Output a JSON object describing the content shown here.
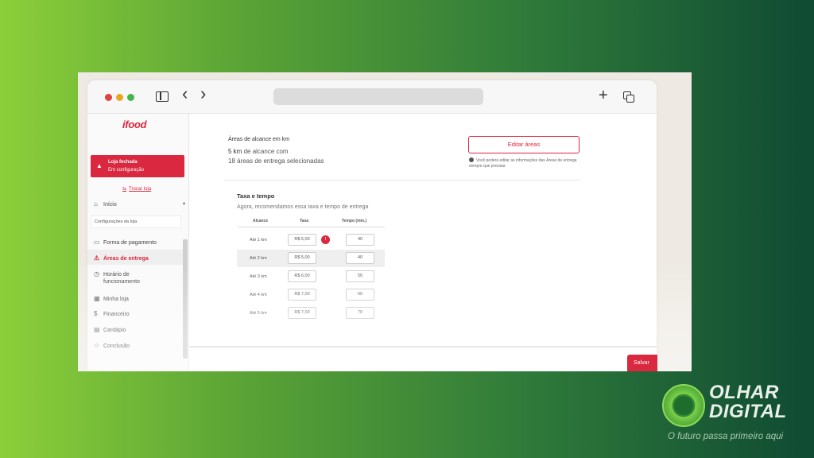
{
  "browser": {
    "back_icon": "‹",
    "forward_icon": "›",
    "new_tab_icon": "+",
    "icons": [
      "sidebar-toggle-icon",
      "back-icon",
      "forward-icon",
      "new-tab-icon",
      "tabs-overview-icon"
    ]
  },
  "sidebar": {
    "logo": "ifood",
    "status_title": "Loja fechada",
    "status_subtitle": "Em configuração",
    "toggle_store": "Trocar loja",
    "home": "Início",
    "section_label": "Configurações da loja",
    "items": [
      {
        "label": "Forma de pagamento",
        "icon": "payment-icon"
      },
      {
        "label": "Áreas de entrega",
        "icon": "warning-icon",
        "active": true
      },
      {
        "label": "Horário de",
        "label2": "funcionamento",
        "icon": "clock-icon"
      },
      {
        "label": "Minha loja",
        "icon": "store-icon"
      },
      {
        "label": "Financeiro",
        "icon": "dollar-icon"
      },
      {
        "label": "Cardápio",
        "icon": "menu-icon"
      },
      {
        "label": "Conclusão",
        "icon": "star-icon"
      }
    ]
  },
  "main": {
    "reach_title": "Áreas de alcance em km",
    "reach_km_value": "5 km",
    "reach_km_suffix": " de alcance com",
    "reach_areas": "18 áreas de entrega selecionadas",
    "edit_button": "Editar áreas",
    "edit_note": "Você poderá editar as informações das Áreas de entrega sempre que precisar.",
    "rate_title": "Taxa e tempo",
    "rate_subtitle": "Agora, recomendamos essa taxa e tempo de entrega",
    "table": {
      "headers": [
        "Alcance",
        "Taxa",
        "Tempo (min.)"
      ],
      "rows": [
        {
          "distance": "Até 1 km",
          "fee": "R$ 5,00",
          "time": "40",
          "badge": "!"
        },
        {
          "distance": "Até 2 km",
          "fee": "R$ 5,00",
          "time": "40"
        },
        {
          "distance": "Até 3 km",
          "fee": "R$ 6,00",
          "time": "50"
        },
        {
          "distance": "Até 4 km",
          "fee": "R$ 7,00",
          "time": "60"
        },
        {
          "distance": "Até 5 km",
          "fee": "R$ 7,00",
          "time": "70"
        }
      ]
    },
    "save_button": "Salvar"
  },
  "watermark": {
    "name_line1": "OLHAR",
    "name_line2": "DIGITAL",
    "tagline": "O futuro passa primeiro aqui"
  },
  "colors": {
    "accent": "#d9283f",
    "background_left": "#8ccf3a",
    "background_right": "#0f4a33"
  }
}
